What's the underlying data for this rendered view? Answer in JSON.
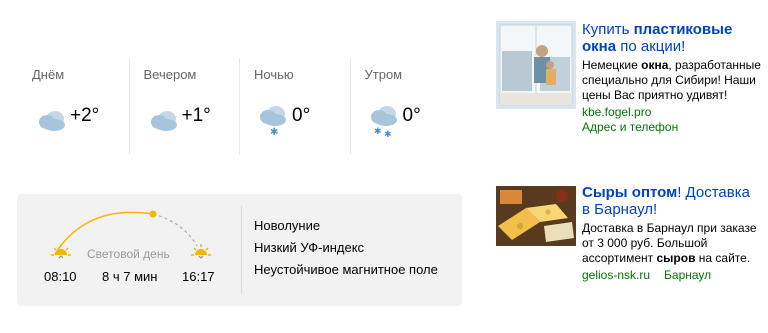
{
  "forecast": {
    "parts": [
      {
        "label": "Днём",
        "temp": "+2°",
        "icon": "cloudy-icon"
      },
      {
        "label": "Вечером",
        "temp": "+1°",
        "icon": "cloudy-icon"
      },
      {
        "label": "Ночью",
        "temp": "0°",
        "icon": "cloud-snow-light-icon"
      },
      {
        "label": "Утром",
        "temp": "0°",
        "icon": "cloud-snow-icon"
      }
    ]
  },
  "daylight": {
    "label": "Световой день",
    "sunrise": "08:10",
    "duration": "8 ч 7 мин",
    "sunset": "16:17",
    "progress": 0.62,
    "facts": [
      "Новолуние",
      "Низкий УФ-индекс",
      "Неустойчивое магнитное поле"
    ]
  },
  "ads": [
    {
      "title_pre": "Купить ",
      "title_bold": "пластиковые окна",
      "title_post": " по акции!",
      "text_pre": "Немецкие ",
      "text_bold": "окна",
      "text_post": ", разработанные специально для Сибири! Наши цены Вас приятно удивят!",
      "domain": "kbe.fogel.pro",
      "contacts": "Адрес и телефон"
    },
    {
      "title_bold": "Сыры оптом",
      "title_post": "! Доставка в Барнаул!",
      "text_pre": "Доставка в Барнаул при заказе от 3 000 руб. Большой ассортимент ",
      "text_bold": "сыров",
      "text_post": " на сайте.",
      "domain": "gelios-nsk.ru",
      "region": "Барнаул"
    }
  ],
  "colors": {
    "link": "#0044bb",
    "green": "#007700",
    "sun": "#f5b800",
    "cloud": "#a8c4dc"
  }
}
